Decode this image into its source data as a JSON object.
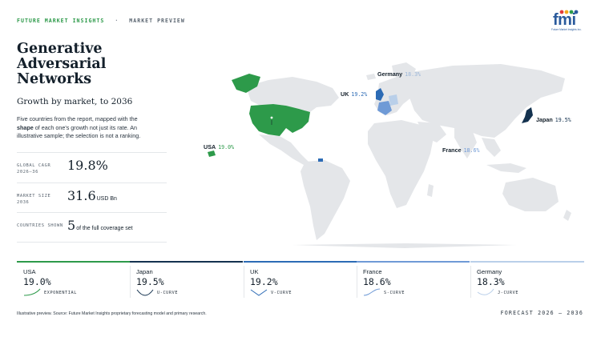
{
  "header": {
    "brand": "FUTURE MARKET INSIGHTS",
    "separator": "·",
    "section": "MARKET PREVIEW",
    "logo_text": "fmi",
    "logo_sub": "Future Market Insights Inc.",
    "logo_colors": [
      "#e23b3b",
      "#f2a81d",
      "#2d9a4a",
      "#2a5a9c"
    ]
  },
  "title": "Generative Adversarial Networks",
  "subtitle": "Growth by market, to 2036",
  "description": {
    "before": "Five countries from the report, mapped with the ",
    "bold": "shape",
    "after": " of each one's growth not just its rate. An illustrative sample; the selection is not a ranking."
  },
  "stats": [
    {
      "label": "GLOBAL CAGR 2026–36",
      "value": "19.8%",
      "unit": ""
    },
    {
      "label": "MARKET SIZE 2036",
      "value": "31.6",
      "unit": "USD Bn"
    },
    {
      "label": "COUNTRIES SHOWN",
      "value": "5",
      "unit": "of the full coverage set"
    }
  ],
  "map_labels": [
    {
      "country": "Germany",
      "rate": "18.3%"
    },
    {
      "country": "UK",
      "rate": "19.2%"
    },
    {
      "country": "Japan",
      "rate": "19.5%"
    },
    {
      "country": "USA",
      "rate": "19.0%"
    },
    {
      "country": "France",
      "rate": "18.6%"
    }
  ],
  "cards": [
    {
      "country": "USA",
      "rate": "19.0%",
      "curve": "EXPONENTIAL",
      "color": "#2d9a4a"
    },
    {
      "country": "Japan",
      "rate": "19.5%",
      "curve": "U-CURVE",
      "color": "#14324f"
    },
    {
      "country": "UK",
      "rate": "19.2%",
      "curve": "V-CURVE",
      "color": "#2c6bb5"
    },
    {
      "country": "France",
      "rate": "18.6%",
      "curve": "S-CURVE",
      "color": "#6f9ad6"
    },
    {
      "country": "Germany",
      "rate": "18.3%",
      "curve": "J-CURVE",
      "color": "#b9cfe9"
    }
  ],
  "footer": {
    "note": "Illustrative preview. Source: Future Market Insights proprietary forecasting model and primary research.",
    "forecast": "FORECAST 2026 – 2036"
  },
  "colors": {
    "land": "#e4e6e9",
    "usa": "#2d9a4a",
    "japan": "#14324f",
    "uk": "#2c6bb5",
    "france": "#6f9ad6",
    "germany": "#b9cfe9"
  }
}
